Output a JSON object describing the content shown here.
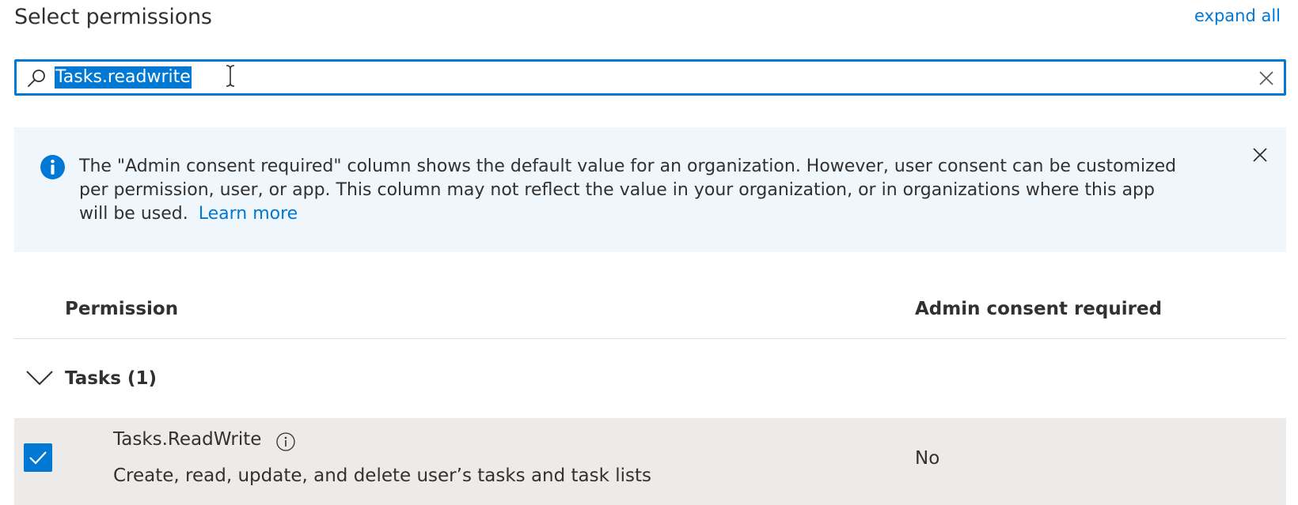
{
  "header": {
    "title": "Select permissions",
    "expand_all_label": "expand all"
  },
  "search": {
    "value": "Tasks.readwrite",
    "icon": "search-icon",
    "clear_icon": "close-icon"
  },
  "banner": {
    "message": "The \"Admin consent required\" column shows the default value for an organization. However, user consent can be customized per permission, user, or app. This column may not reflect the value in your organization, or in organizations where this app will be used.",
    "learn_more": "Learn more",
    "icon": "info-icon",
    "close_icon": "close-icon"
  },
  "table": {
    "columns": [
      "Permission",
      "Admin consent required"
    ],
    "groups": [
      {
        "label": "Tasks (1)",
        "expanded": true,
        "items": [
          {
            "name": "Tasks.ReadWrite",
            "description": "Create, read, update, and delete user’s tasks and task lists",
            "admin_consent": "No",
            "checked": true
          }
        ]
      }
    ]
  },
  "colors": {
    "accent": "#0078d4",
    "banner_bg": "#eff6fc",
    "selected_row_bg": "#edebe9",
    "text": "#323130"
  }
}
